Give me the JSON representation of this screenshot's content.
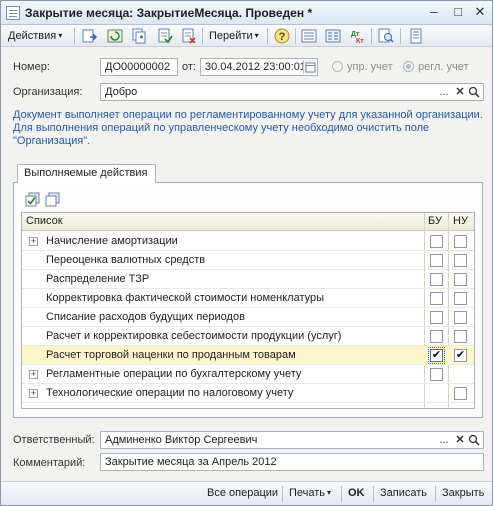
{
  "window": {
    "title": "Закрытие месяца: ЗакрытиеМесяца. Проведен *"
  },
  "toolbar": {
    "actions_label": "Действия",
    "goto_label": "Перейти"
  },
  "header": {
    "number_label": "Номер:",
    "number_value": "ДО00000002",
    "date_label": "от:",
    "date_value": "30.04.2012 23:00:01",
    "mgmt_radio_label": "упр. учет",
    "reg_radio_label": "регл. учет",
    "org_label": "Организация:",
    "org_value": "Добро",
    "note_text": "Документ выполняет операции по регламентированному учету для указанной организации. Для выполнения операций по управленческому учету необходимо очистить поле \"Организация\"."
  },
  "tabs": {
    "actions_tab": "Выполняемые действия"
  },
  "table": {
    "col_list": "Список",
    "col_bu": "БУ",
    "col_nu": "НУ",
    "rows": [
      {
        "label": "Начисление амортизации",
        "group": true,
        "bu": false,
        "nu": false
      },
      {
        "label": "Переоценка валютных средств",
        "group": false,
        "bu": false,
        "nu": false
      },
      {
        "label": "Распределение ТЗР",
        "group": false,
        "bu": false,
        "nu": false
      },
      {
        "label": "Корректировка фактической стоимости номенклатуры",
        "group": false,
        "bu": false,
        "nu": false
      },
      {
        "label": "Списание расходов будущих периодов",
        "group": false,
        "bu": false,
        "nu": false
      },
      {
        "label": "Расчет и корректировка себестоимости продукции (услуг)",
        "group": false,
        "bu": false,
        "nu": false
      },
      {
        "label": "Расчет торговой наценки по проданным товарам",
        "group": false,
        "bu": true,
        "nu": true
      },
      {
        "label": "Регламентные операции по бухгалтерскому учету",
        "group": true,
        "bu": false,
        "nu": null
      },
      {
        "label": "Технологические операции по налоговому учету",
        "group": true,
        "bu": null,
        "nu": false
      }
    ]
  },
  "footer": {
    "responsible_label": "Ответственный:",
    "responsible_value": "Админенко Виктор Сергеевич",
    "comment_label": "Комментарий:",
    "comment_value": "Закрытие месяца за Апрель 2012"
  },
  "bottom": {
    "all_ops": "Все операции",
    "print": "Печать",
    "ok": "OK",
    "save": "Записать",
    "close": "Закрыть"
  },
  "icons": {
    "check_mark": "✔",
    "caret": "▾",
    "clear": "✕",
    "search": "⚲",
    "dots": "...",
    "minimize": "–",
    "maximize": "□",
    "close": "✕",
    "help": "?"
  }
}
